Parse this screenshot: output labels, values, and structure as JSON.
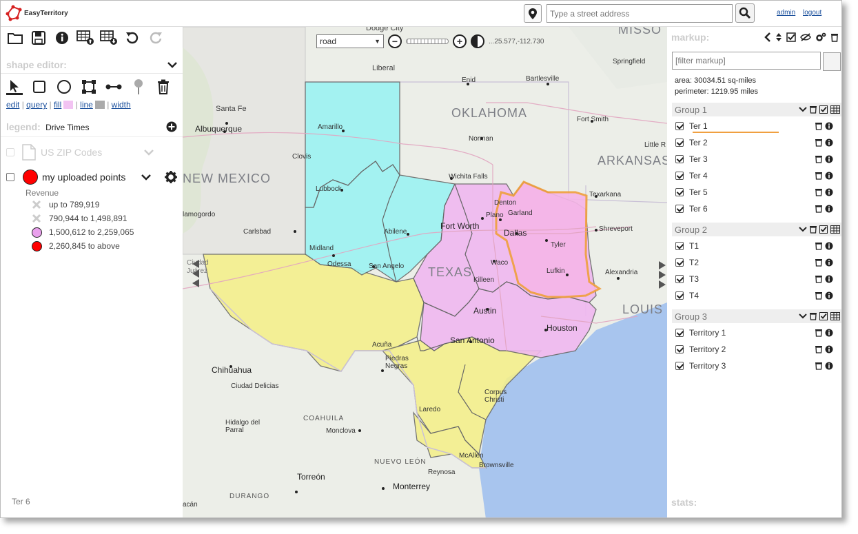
{
  "app": {
    "logo_text": "EasyTerritory"
  },
  "header": {
    "address_placeholder": "Type a street address",
    "links": [
      "admin",
      "logout"
    ]
  },
  "left_panel": {
    "shape_editor_title": "shape editor:",
    "edit_links": {
      "edit": "edit",
      "query": "query",
      "fill": "fill",
      "line": "line",
      "width": "width",
      "sep": "|"
    },
    "fill_color": "#f2c3f2",
    "line_color": "#aaaaaa",
    "legend_label": "legend:",
    "legend_value": "Drive Times",
    "layers": [
      {
        "name": "US ZIP Codes",
        "enabled": false
      },
      {
        "name": "my uploaded points",
        "enabled": true,
        "color": "#ff0000"
      }
    ],
    "revenue_title": "Revenue",
    "revenue_ranges": [
      {
        "label": "up to 789,919",
        "symbol": "x-icon"
      },
      {
        "label": "790,944 to 1,498,891",
        "symbol": "x-icon"
      },
      {
        "label": "1,500,612 to 2,259,065",
        "color": "#e9a0ec"
      },
      {
        "label": "2,260,845 to above",
        "color": "#ff0000"
      }
    ],
    "status_text": "Ter 6"
  },
  "map": {
    "map_type": "road",
    "coordinates": "...25.577,-112.730",
    "colors": {
      "cyan": "#9cf3f3",
      "pink": "#f0b8f0",
      "yellow": "#f5f08a",
      "water": "#a8c5ee"
    },
    "labels": {
      "oklahoma": "OKLAHOMA",
      "new_mexico": "NEW MEXICO",
      "texas": "TEXAS",
      "arkansas": "ARKANSAS",
      "louisiana": "LOUIS",
      "missouri": "MISSO",
      "coahuila": "COAHUILA",
      "nuevo_leon": "NUEVO LEÓN",
      "durango": "DURANGO",
      "chihuahua": "Chihuahua",
      "torreon": "Torreón",
      "monterrey": "Monterrey",
      "albuquerque": "Albuquerque",
      "santa_fe": "Santa Fe",
      "amarillo": "Amarillo",
      "lubbock": "Lubbock",
      "clovis": "Clovis",
      "midland": "Midland",
      "odessa": "Odessa",
      "abilene": "Abilene",
      "san_angelo": "San Angelo",
      "wichita_falls": "Wichita Falls",
      "fort_worth": "Fort Worth",
      "denton": "Denton",
      "plano": "Plano",
      "garland": "Garland",
      "dallas": "Dallas",
      "tyler": "Tyler",
      "waco": "Waco",
      "killeen": "Killeen",
      "austin": "Austin",
      "san_antonio": "San Antonio",
      "houston": "Houston",
      "lufkin": "Lufkin",
      "shreveport": "Shreveport",
      "texarkana": "Texarkana",
      "alexandria": "Alexandria",
      "fort_smith": "Fort Smith",
      "little_rock": "Little R",
      "norman": "Norman",
      "enid": "Enid",
      "bartlesville": "Bartlesville",
      "springfield": "Springfield",
      "liberal": "Liberal",
      "dodge_city": "Dodge City",
      "carlsbad": "Carlsbad",
      "alamogordo": "lamogordo",
      "ciudad_juarez": "Ciudad\nJuárez",
      "acuna": "Acuña",
      "piedras_negras": "Piedras\nNegras",
      "laredo": "Laredo",
      "corpus_christi": "Corpus\nChristi",
      "mcallen": "McAllen",
      "brownsville": "Brownsville",
      "reynosa": "Reynosa",
      "monclova": "Monclova",
      "ciudad_delicias": "Ciudad Delicias",
      "hidalgo_del_parral": "Hidalgo del\nParral",
      "culiacan": "acán"
    }
  },
  "right_panel": {
    "title": "markup:",
    "filter_placeholder": "[filter markup]",
    "area": "area: 30034.51 sq-miles",
    "perimeter": "perimeter: 1219.95 miles",
    "groups": [
      {
        "name": "Group 1",
        "items": [
          "Ter 1",
          "Ter 2",
          "Ter 3",
          "Ter 4",
          "Ter 5",
          "Ter 6"
        ]
      },
      {
        "name": "Group 2",
        "items": [
          "T1",
          "T2",
          "T3",
          "T4"
        ]
      },
      {
        "name": "Group 3",
        "items": [
          "Territory 1",
          "Territory 2",
          "Territory 3"
        ]
      }
    ],
    "selected_underline_color": "#f0a040",
    "stats_title": "stats:"
  }
}
